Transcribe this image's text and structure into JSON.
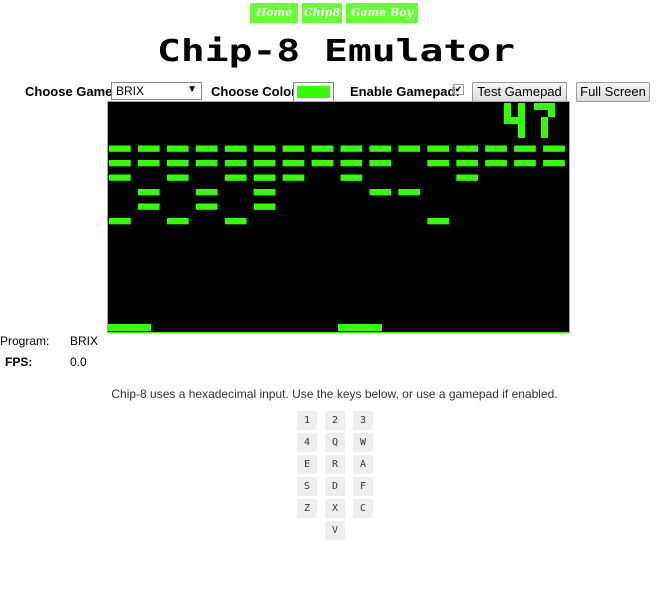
{
  "nav": {
    "home": "Home",
    "chip8": "Chip8",
    "gameboy": "Game Boy"
  },
  "title": "Chip-8 Emulator",
  "controls": {
    "choose_game_label": "Choose Game:",
    "selected_game": "BRIX",
    "choose_color_label": "Choose Color:",
    "color_value": "#33ff00",
    "enable_gamepad_label": "Enable Gamepad:",
    "gamepad_enabled": true,
    "gamepad_check_glyph": "✔",
    "test_gamepad_label": "Test Gamepad",
    "full_screen_label": "Full Screen"
  },
  "screen": {
    "pixel_color": "#33ff00",
    "background": "#000000",
    "score": "47"
  },
  "info": {
    "program_label": "Program:",
    "program_value": "BRIX",
    "fps_label": "FPS:",
    "fps_value": "0.0"
  },
  "help_text": "Chip-8 uses a hexadecimal input. Use the keys below, or use a gamepad if enabled.",
  "keypad": [
    [
      "1",
      "2",
      "3"
    ],
    [
      "4",
      "Q",
      "W"
    ],
    [
      "E",
      "R",
      "A"
    ],
    [
      "S",
      "D",
      "F"
    ],
    [
      "Z",
      "X",
      "C"
    ],
    [
      "V"
    ]
  ],
  "colors": {
    "nav_bg": "#66ff33",
    "accent": "#33ff00"
  }
}
